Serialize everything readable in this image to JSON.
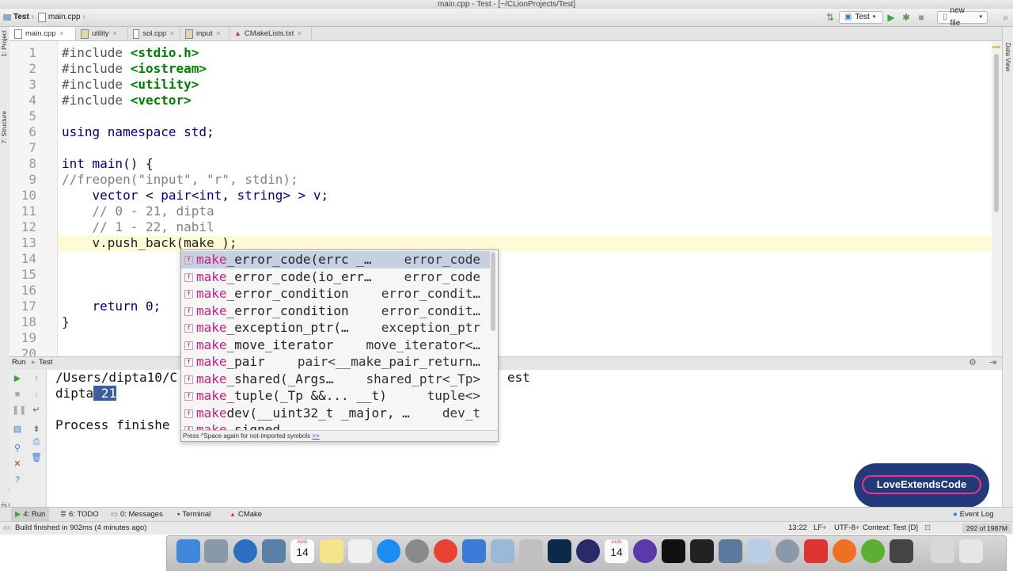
{
  "window": {
    "title": "main.cpp - Test - [~/CLionProjects/Test]"
  },
  "navbar": {
    "breadcrumb_project": "Test",
    "breadcrumb_file": "main.cpp",
    "run_config": "Test",
    "new_file": "new file"
  },
  "tabs": [
    {
      "label": "main.cpp",
      "active": true
    },
    {
      "label": "utility",
      "active": false
    },
    {
      "label": "sol.cpp",
      "active": false
    },
    {
      "label": "input",
      "active": false
    },
    {
      "label": "CMakeLists.txt",
      "active": false
    }
  ],
  "left_strip": {
    "project": "1: Project",
    "structure": "7: Structure",
    "favorites": "2: Favorites"
  },
  "right_strip": {
    "data_view": "Data View"
  },
  "editor": {
    "line_numbers": [
      "1",
      "2",
      "3",
      "4",
      "5",
      "6",
      "7",
      "8",
      "9",
      "10",
      "11",
      "12",
      "13",
      "14",
      "15",
      "16",
      "17",
      "18",
      "19",
      "20"
    ],
    "current_line": 13,
    "lines": [
      {
        "a": "#include ",
        "b": "<stdio.h>"
      },
      {
        "a": "#include ",
        "b": "<iostream>"
      },
      {
        "a": "#include ",
        "b": "<utility>"
      },
      {
        "a": "#include ",
        "b": "<vector>"
      },
      {
        "a": "",
        "b": ""
      },
      {
        "a": "using namespace std;",
        "b": ""
      },
      {
        "a": "",
        "b": ""
      },
      {
        "a": "int main() {",
        "b": ""
      },
      {
        "a": "//freopen(\"input\", \"r\", stdin);",
        "b": ""
      },
      {
        "a": "    vector < pair<int, string> > v;",
        "b": ""
      },
      {
        "a": "    // 0 - 21, dipta",
        "b": ""
      },
      {
        "a": "    // 1 - 22, nabil",
        "b": ""
      },
      {
        "a": "    v.push_back(make_);",
        "b": ""
      },
      {
        "a": "",
        "b": ""
      },
      {
        "a": "",
        "b": ""
      },
      {
        "a": "",
        "b": ""
      },
      {
        "a": "    return 0;",
        "b": ""
      },
      {
        "a": "}",
        "b": ""
      },
      {
        "a": "",
        "b": ""
      },
      {
        "a": "",
        "b": ""
      }
    ]
  },
  "autocomplete": {
    "prefix": "make",
    "items": [
      {
        "rest": "_error_code(errc _…",
        "ret": "error_code",
        "selected": true
      },
      {
        "rest": "_error_code(io_err…",
        "ret": "error_code",
        "selected": false
      },
      {
        "rest": "_error_condition",
        "ret": "error_condit…",
        "selected": false
      },
      {
        "rest": "_error_condition",
        "ret": "error_condit…",
        "selected": false
      },
      {
        "rest": "_exception_ptr(…",
        "ret": "exception_ptr",
        "selected": false
      },
      {
        "rest": "_move_iterator",
        "ret": "move_iterator<…",
        "selected": false
      },
      {
        "rest": "_pair",
        "ret": "pair<__make_pair_return…",
        "selected": false
      },
      {
        "rest": "_shared(_Args…",
        "ret": "shared_ptr<_Tp>",
        "selected": false
      },
      {
        "rest": "_tuple(_Tp &&... __t)",
        "ret": "tuple<>",
        "selected": false
      },
      {
        "rest": "dev(__uint32_t _major, …",
        "ret": "dev_t",
        "selected": false
      },
      {
        "rest": "_signed",
        "ret": "",
        "selected": false
      }
    ],
    "footer": "Press ^Space again for not-imported symbols",
    "footer_link": ">>"
  },
  "run_panel": {
    "label": "Run",
    "config": "Test",
    "console_line1": "/Users/dipta10/C",
    "console_line1_tail": "est",
    "console_line2_a": "dipta",
    "console_line2_sel": " 21",
    "console_line3": "Process finishe"
  },
  "badge": {
    "text": "LoveExtendsCode"
  },
  "tool_tabs": [
    {
      "label": "4: Run",
      "active": true
    },
    {
      "label": "6: TODO",
      "active": false
    },
    {
      "label": "0: Messages",
      "active": false
    },
    {
      "label": "Terminal",
      "active": false
    },
    {
      "label": "CMake",
      "active": false
    }
  ],
  "event_log": "Event Log",
  "status": {
    "message": "Build finished in 902ms (4 minutes ago)",
    "position": "13:22",
    "line_sep": "LF÷",
    "encoding": "UTF-8÷",
    "context": "Context: Test [D]",
    "memory": "292 of 1987M"
  },
  "dock": {
    "calendar_month": "AUG",
    "calendar_day": "14"
  },
  "colors": {
    "accent": "#c8217e",
    "selection": "#3d5e9e",
    "badge": "#233a7a",
    "badge_border": "#ff2d8a"
  }
}
